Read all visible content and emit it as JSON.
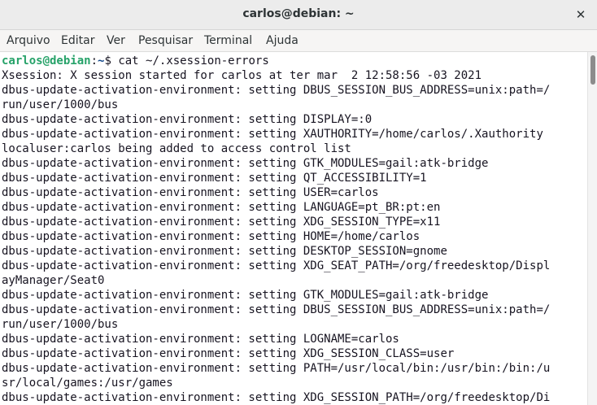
{
  "window": {
    "title": "carlos@debian: ~",
    "close_glyph": "✕"
  },
  "menubar": {
    "items": [
      {
        "label": "Arquivo"
      },
      {
        "label": "Editar"
      },
      {
        "label": "Ver"
      },
      {
        "label": "Pesquisar"
      },
      {
        "label": "Terminal"
      },
      {
        "label": "Ajuda"
      }
    ]
  },
  "terminal": {
    "prompt": {
      "user_host": "carlos@debian",
      "separator": ":",
      "path": "~",
      "symbol": "$ ",
      "command": "cat ~/.xsession-errors"
    },
    "lines": [
      "Xsession: X session started for carlos at ter mar  2 12:58:56 -03 2021",
      "dbus-update-activation-environment: setting DBUS_SESSION_BUS_ADDRESS=unix:path=/",
      "run/user/1000/bus",
      "dbus-update-activation-environment: setting DISPLAY=:0",
      "dbus-update-activation-environment: setting XAUTHORITY=/home/carlos/.Xauthority",
      "localuser:carlos being added to access control list",
      "dbus-update-activation-environment: setting GTK_MODULES=gail:atk-bridge",
      "dbus-update-activation-environment: setting QT_ACCESSIBILITY=1",
      "dbus-update-activation-environment: setting USER=carlos",
      "dbus-update-activation-environment: setting LANGUAGE=pt_BR:pt:en",
      "dbus-update-activation-environment: setting XDG_SESSION_TYPE=x11",
      "dbus-update-activation-environment: setting HOME=/home/carlos",
      "dbus-update-activation-environment: setting DESKTOP_SESSION=gnome",
      "dbus-update-activation-environment: setting XDG_SEAT_PATH=/org/freedesktop/Displ",
      "ayManager/Seat0",
      "dbus-update-activation-environment: setting GTK_MODULES=gail:atk-bridge",
      "dbus-update-activation-environment: setting DBUS_SESSION_BUS_ADDRESS=unix:path=/",
      "run/user/1000/bus",
      "dbus-update-activation-environment: setting LOGNAME=carlos",
      "dbus-update-activation-environment: setting XDG_SESSION_CLASS=user",
      "dbus-update-activation-environment: setting PATH=/usr/local/bin:/usr/bin:/bin:/u",
      "sr/local/games:/usr/games",
      "dbus-update-activation-environment: setting XDG_SESSION_PATH=/org/freedesktop/Di"
    ]
  },
  "colors": {
    "prompt_user": "#26a269",
    "prompt_path": "#12488b",
    "text": "#171421",
    "titlebar": "#ececec"
  }
}
